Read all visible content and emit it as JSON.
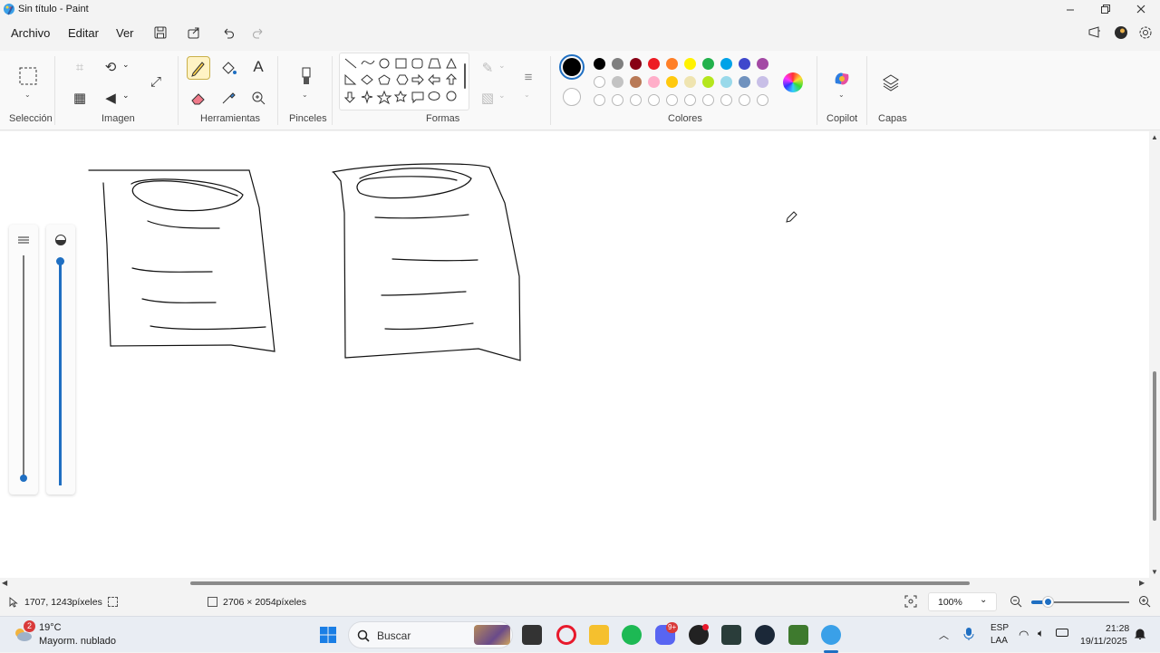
{
  "window": {
    "title": "Sin título - Paint"
  },
  "menu": {
    "items": [
      "Archivo",
      "Editar",
      "Ver"
    ]
  },
  "ribbon": {
    "groups": {
      "seleccion": "Selección",
      "imagen": "Imagen",
      "herramientas": "Herramientas",
      "pinceles": "Pinceles",
      "formas": "Formas",
      "colores": "Colores",
      "copilot": "Copilot",
      "capas": "Capas"
    },
    "text_tool_glyph": "A",
    "palette_row1": [
      "#000000",
      "#7f7f7f",
      "#880015",
      "#ed1c24",
      "#ff7f27",
      "#fff200",
      "#22b14c",
      "#00a2e8",
      "#3f48cc",
      "#a349a4"
    ],
    "palette_row2": [
      "#ffffff",
      "#c3c3c3",
      "#b97a57",
      "#ffaec9",
      "#ffc90e",
      "#efe4b0",
      "#b5e61d",
      "#99d9ea",
      "#7092be",
      "#c8bfe7"
    ],
    "primary_color": "#000000",
    "secondary_color": "#ffffff"
  },
  "status": {
    "cursor_pos": "1707, 1243píxeles",
    "canvas_size": "2706 × 2054píxeles",
    "zoom": "100%"
  },
  "taskbar": {
    "weather_temp": "19°C",
    "weather_desc": "Mayorm. nublado",
    "weather_badge": "2",
    "search_placeholder": "Buscar",
    "lang_top": "ESP",
    "lang_bottom": "LAA",
    "time": "21:28",
    "date": "19/11/2025",
    "discord_badge": "9+"
  }
}
